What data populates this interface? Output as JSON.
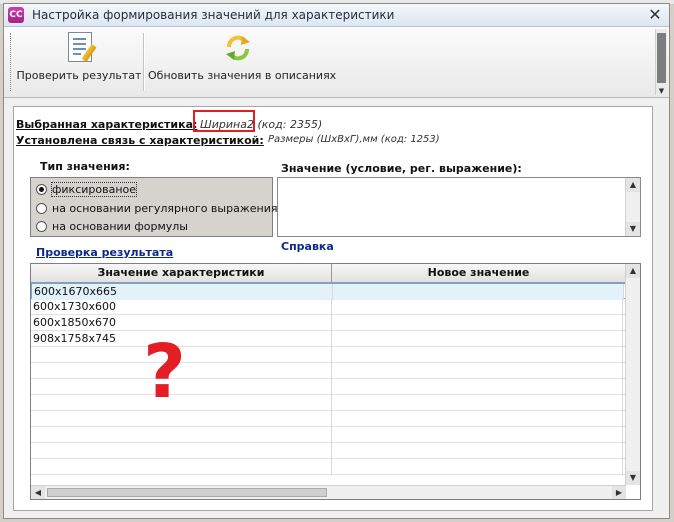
{
  "window": {
    "title": "Настройка формирования значений для характеристики",
    "app_icon_text": "СС",
    "close_glyph": "✕"
  },
  "toolbar": {
    "check_label": "Проверить результат",
    "refresh_label": "Обновить значения в описаниях",
    "scroll_arrow": "▼"
  },
  "info": {
    "selected_label": "Выбранная характеристика:",
    "selected_value": "Ширина2 (код: 2355)",
    "link_label": "Установлена связь с характеристикой:",
    "link_value": "Размеры (ШхВхГ),мм (код: 1253)"
  },
  "value_type": {
    "label": "Тип значения:",
    "options": [
      {
        "label": "фиксированое",
        "selected": true
      },
      {
        "label": "на основании регулярного выражения",
        "selected": false
      },
      {
        "label": "на основании формулы",
        "selected": false
      }
    ]
  },
  "value_input": {
    "label": "Значение (условие, рег. выражение):",
    "value": ""
  },
  "help_link": "Справка",
  "result": {
    "label": "Проверка результата",
    "columns": [
      "Значение характеристики",
      "Новое значение"
    ],
    "rows": [
      [
        "600x1670x665",
        ""
      ],
      [
        "600x1730x600",
        ""
      ],
      [
        "600x1850x670",
        ""
      ],
      [
        "908x1758x745",
        ""
      ]
    ]
  },
  "annotation": "?",
  "colors": {
    "highlight": "#e02020",
    "question": "#e31e24",
    "link": "#0c2a8a",
    "selected_row": "#e3f1fb"
  }
}
